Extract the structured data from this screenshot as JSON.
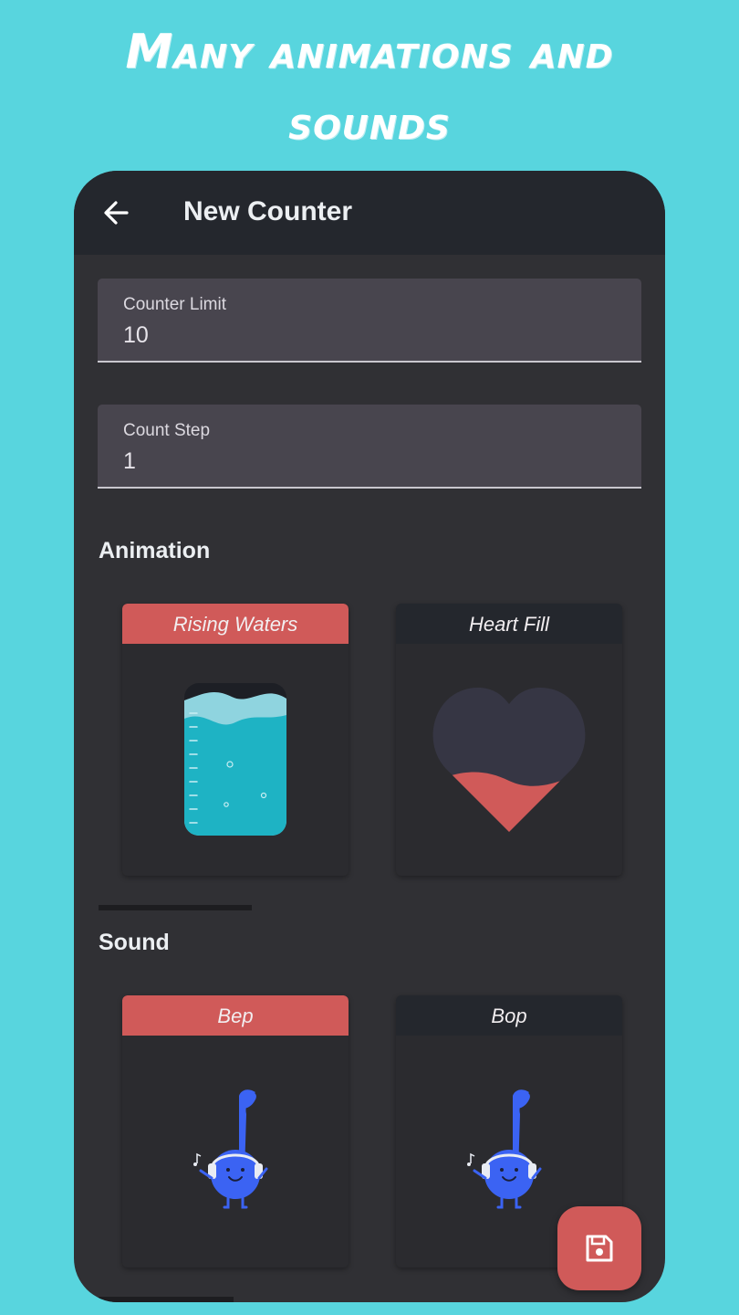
{
  "headline": {
    "line1": "Many animations and",
    "line2": "sounds"
  },
  "appbar": {
    "back_icon": "arrow-left-icon",
    "title": "New Counter"
  },
  "fields": {
    "counter_limit": {
      "label": "Counter Limit",
      "value": "10"
    },
    "count_step": {
      "label": "Count Step",
      "value": "1"
    }
  },
  "animation": {
    "title": "Animation",
    "options": [
      {
        "label": "Rising Waters",
        "selected": true
      },
      {
        "label": "Heart Fill",
        "selected": false
      }
    ]
  },
  "sound": {
    "title": "Sound",
    "options": [
      {
        "label": "Bep",
        "selected": true
      },
      {
        "label": "Bop",
        "selected": false
      }
    ]
  },
  "fab": {
    "icon": "save-icon"
  },
  "colors": {
    "background": "#58d5de",
    "surface": "#303034",
    "appbar": "#24272d",
    "accent": "#d05a59",
    "water": "#1eb3c4",
    "music_note": "#3b63f3"
  }
}
